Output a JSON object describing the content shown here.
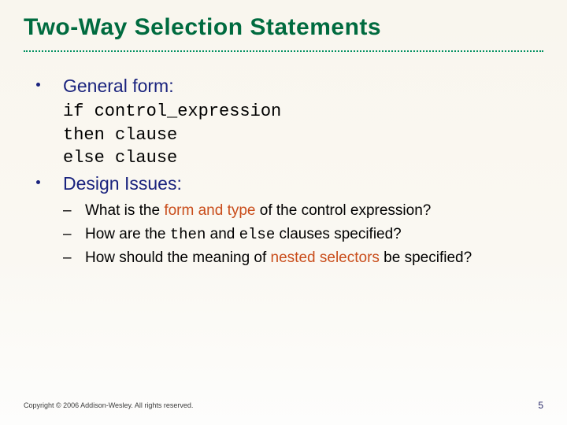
{
  "title": "Two-Way Selection Statements",
  "bullets": {
    "general_form_label": "General form:",
    "code_line1": "if control_expression",
    "code_line2": "then clause",
    "code_line3": "else clause",
    "design_issues_label": "Design Issues:"
  },
  "sub": {
    "q1_a": "What is the ",
    "q1_hl": "form and type",
    "q1_b": " of the control expression?",
    "q2_a": "How are the ",
    "q2_then": "then",
    "q2_mid": " and ",
    "q2_else": "else",
    "q2_b": " clauses specified?",
    "q3_a": "How should the meaning of ",
    "q3_hl": "nested selectors",
    "q3_b": " be specified?"
  },
  "footer": {
    "copyright": "Copyright © 2006 Addison-Wesley. All rights reserved.",
    "page": "5"
  }
}
